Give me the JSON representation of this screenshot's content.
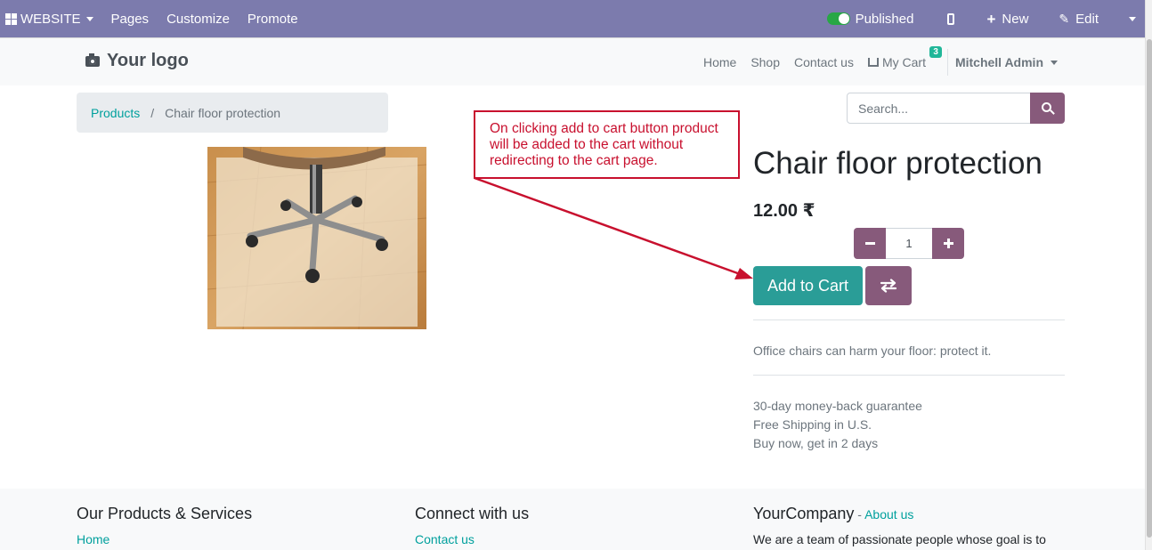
{
  "admin_bar": {
    "website_label": "WEBSITE",
    "pages_label": "Pages",
    "customize_label": "Customize",
    "promote_label": "Promote",
    "published_label": "Published",
    "new_label": "New",
    "edit_label": "Edit"
  },
  "header": {
    "logo_text": "Your logo",
    "nav": {
      "home": "Home",
      "shop": "Shop",
      "contact": "Contact us",
      "cart": "My Cart",
      "cart_count": "3"
    },
    "user_name": "Mitchell Admin"
  },
  "breadcrumb": {
    "parent": "Products",
    "separator": "/",
    "current": "Chair floor protection"
  },
  "search": {
    "placeholder": "Search..."
  },
  "product": {
    "title": "Chair floor protection",
    "price": "12.00 ₹",
    "quantity": "1",
    "add_to_cart_label": "Add to Cart",
    "description": "Office chairs can harm your floor: protect it.",
    "guarantees": [
      "30-day money-back guarantee",
      "Free Shipping in U.S.",
      "Buy now, get in 2 days"
    ]
  },
  "annotation": {
    "line1": "On clicking add to cart  button product",
    "line2": "will be added to the cart without",
    "line3": "redirecting to the cart page."
  },
  "footer": {
    "products_heading": "Our Products & Services",
    "products_link": "Home",
    "connect_heading": "Connect with us",
    "connect_link": "Contact us",
    "company_name": "YourCompany",
    "company_dash": "-",
    "about_link": "About us",
    "company_text": "We are a team of passionate people whose goal is to"
  },
  "colors": {
    "admin_bar": "#7c7bad",
    "primary_purple": "#875a7b",
    "teal_button": "#2a9d97",
    "link_teal": "#00a09d",
    "annotation_red": "#c8102e"
  },
  "icons": [
    "apps-grid-icon",
    "mobile-icon",
    "plus-icon",
    "pencil-icon",
    "camera-icon",
    "shopping-cart-icon",
    "search-icon",
    "minus-icon",
    "exchange-icon"
  ]
}
